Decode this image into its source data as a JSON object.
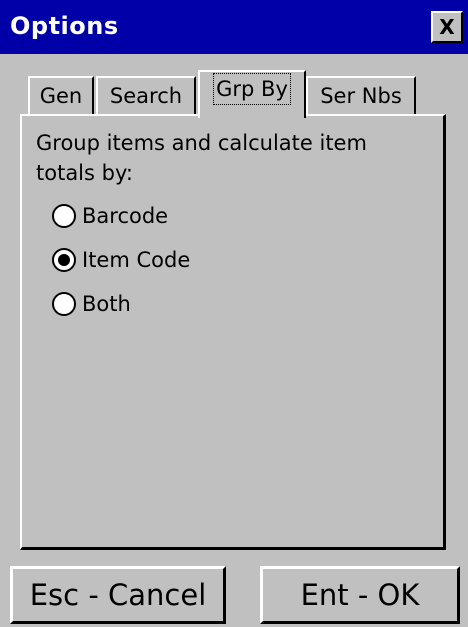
{
  "window": {
    "title": "Options",
    "close_label": "X"
  },
  "tabs": [
    {
      "label": "Gen",
      "active": false
    },
    {
      "label": "Search",
      "active": false
    },
    {
      "label": "Grp By",
      "active": true
    },
    {
      "label": "Ser Nbs",
      "active": false
    }
  ],
  "panel": {
    "prompt": "Group items and calculate item totals by:",
    "options": [
      {
        "label": "Barcode",
        "selected": false
      },
      {
        "label": "Item Code",
        "selected": true
      },
      {
        "label": "Both",
        "selected": false
      }
    ]
  },
  "buttons": {
    "cancel_label": "Esc - Cancel",
    "ok_label": "Ent - OK"
  },
  "colors": {
    "titlebar": "#0000a8",
    "face": "#c0c0c0"
  }
}
